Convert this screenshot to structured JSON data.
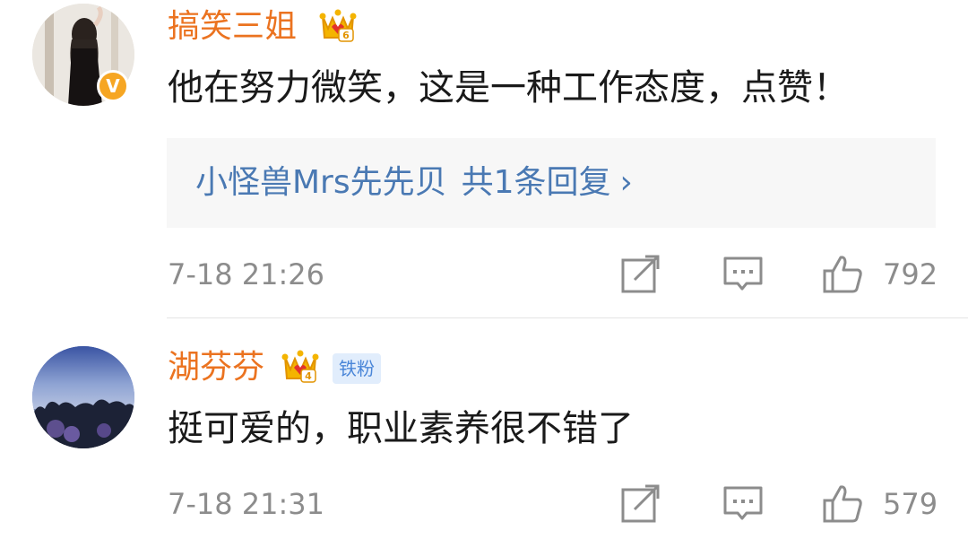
{
  "comments": [
    {
      "username": "搞笑三姐",
      "verified_badge": "V",
      "crown_level": "6",
      "content": "他在努力微笑，这是一种工作态度，点赞！",
      "reply": {
        "user": "小怪兽Mrs先先贝",
        "summary": "共1条回复",
        "chevron": "›"
      },
      "time": "7-18 21:26",
      "likes": "792"
    },
    {
      "username": "湖芬芬",
      "crown_level": "4",
      "fan_tag": "铁粉",
      "content": "挺可爱的，职业素养很不错了",
      "time": "7-18 21:31",
      "likes": "579"
    }
  ],
  "colors": {
    "username": "#eb7320",
    "reply_link": "#4a79b3",
    "meta": "#8c8c8c",
    "badge": "#f6a623",
    "fan_tag_bg": "#e1edfc"
  },
  "icons": [
    "share-icon",
    "comment-icon",
    "thumbs-up-icon",
    "crown-icon",
    "verified-badge-icon"
  ]
}
